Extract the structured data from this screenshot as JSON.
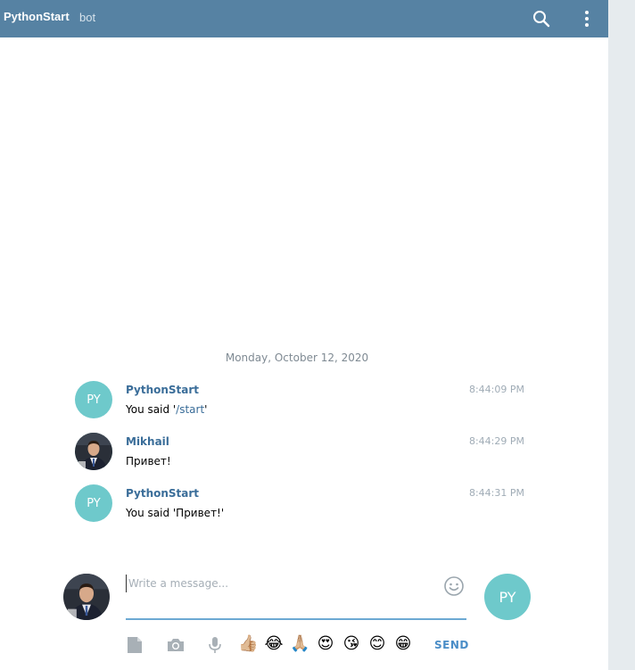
{
  "header": {
    "title": "PythonStart",
    "subtitle": "bot"
  },
  "date_separator": "Monday, October 12, 2020",
  "messages": [
    {
      "author": "PythonStart",
      "time": "8:44:09 PM",
      "avatar_initials": "PY",
      "text_prefix": "You said '",
      "command": "/start",
      "text_suffix": "'"
    },
    {
      "author": "Mikhail",
      "time": "8:44:29 PM",
      "text": "Привет!"
    },
    {
      "author": "PythonStart",
      "time": "8:44:31 PM",
      "avatar_initials": "PY",
      "text": "You said 'Привет!'"
    }
  ],
  "compose": {
    "placeholder": "Write a message...",
    "bot_initials": "PY",
    "send_label": "SEND"
  },
  "emojis": [
    "👍🏼",
    "😂",
    "🙏🏼",
    "😍",
    "😘",
    "😊",
    "😁"
  ],
  "colors": {
    "header": "#5682a3",
    "accent": "#3a6d99",
    "avatar": "#6ec9cb",
    "send": "#4a8dc7"
  }
}
